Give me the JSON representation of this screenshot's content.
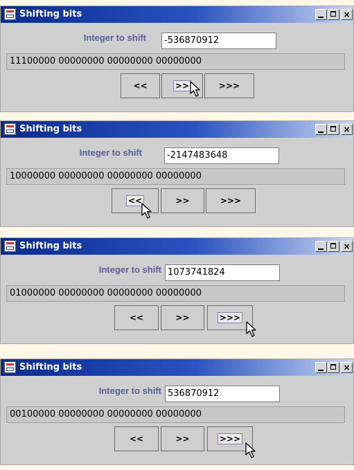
{
  "windows": [
    {
      "title": "Shifting bits",
      "label": "Integer to shift",
      "value": "-536870912",
      "binary": "11100000 00000000 00000000 00000000",
      "buttons": [
        "<<",
        ">>",
        ">>>"
      ],
      "focused": 1
    },
    {
      "title": "Shifting bits",
      "label": "Integer to shift",
      "value": "-2147483648",
      "binary": "10000000 00000000 00000000 00000000",
      "buttons": [
        "<<",
        ">>",
        ">>>"
      ],
      "focused": 0
    },
    {
      "title": "Shifting bits",
      "label": "Integer to shift",
      "value": "1073741824",
      "binary": "01000000 00000000 00000000 00000000",
      "buttons": [
        "<<",
        ">>",
        ">>>"
      ],
      "focused": 2
    },
    {
      "title": "Shifting bits",
      "label": "Integer to shift",
      "value": "536870912",
      "binary": "00100000 00000000 00000000 00000000",
      "buttons": [
        "<<",
        ">>",
        ">>>"
      ],
      "focused": 2
    }
  ],
  "colors": {
    "title_gradient_start": "#0a2b8e",
    "title_gradient_end": "#c9d6f1",
    "label": "#5d5d99",
    "window_bg": "#cfcfcf",
    "page_bg": "#fdf7e7"
  },
  "icons": {
    "app": "java-cup-icon",
    "cursor": "arrow-cursor-icon"
  }
}
